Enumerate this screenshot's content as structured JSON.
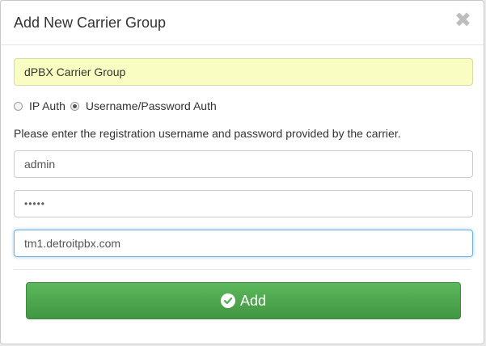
{
  "modal": {
    "title": "Add New Carrier Group",
    "close_glyph": "✖"
  },
  "form": {
    "group_name_value": "dPBX Carrier Group",
    "auth_options": [
      {
        "label": "IP Auth",
        "checked": false
      },
      {
        "label": "Username/Password Auth",
        "checked": true
      }
    ],
    "help_text": "Please enter the registration username and password provided by the carrier.",
    "username_value": "admin",
    "password_masked": "•••••",
    "host_value": "tm1.detroitpbx.com"
  },
  "actions": {
    "add_label": "Add",
    "add_icon": "check-circle-icon"
  },
  "colors": {
    "highlight_field": "#fafdc2",
    "button_green": "#5cb85c",
    "focus_blue": "#66afe9"
  }
}
